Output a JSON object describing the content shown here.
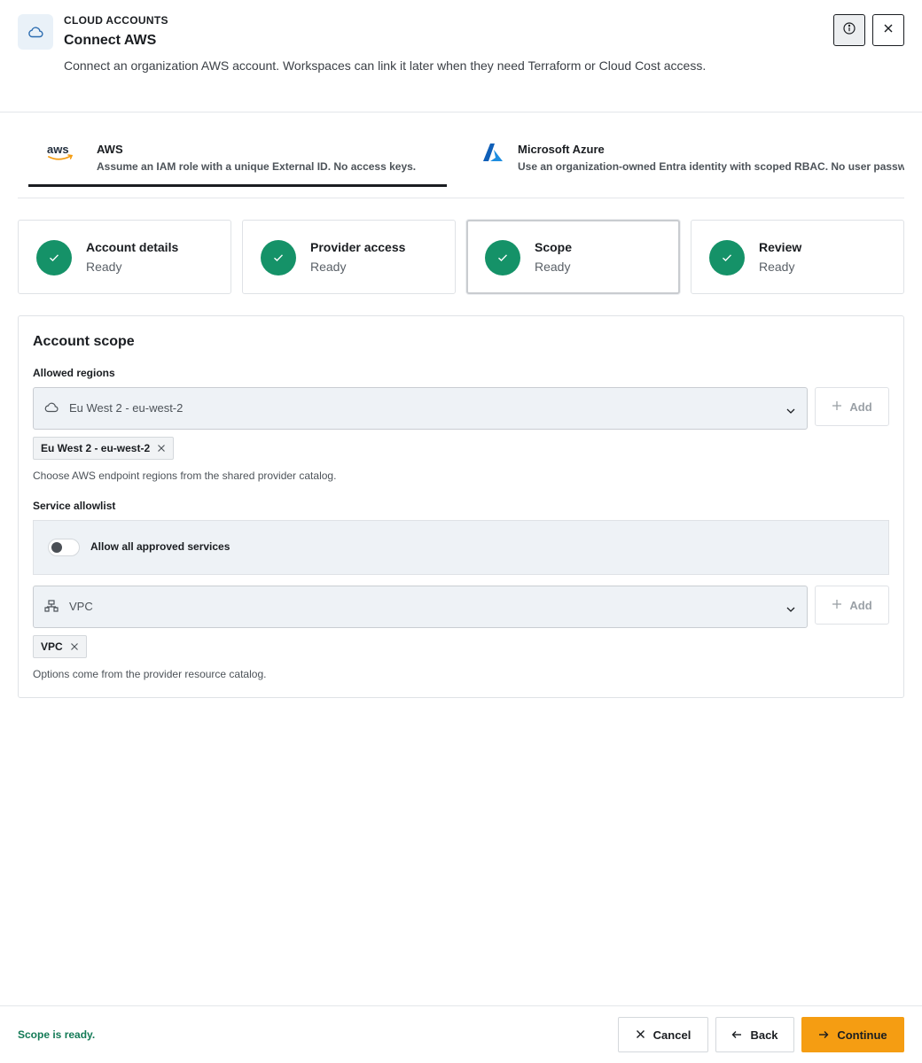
{
  "header": {
    "eyebrow": "CLOUD ACCOUNTS",
    "title": "Connect AWS",
    "description": "Connect an organization AWS account. Workspaces can link it later when they need Terraform or Cloud Cost access.",
    "icon": "cloud-icon"
  },
  "providers": [
    {
      "title": "AWS",
      "subtitle": "Assume an IAM role with a unique External ID. No access keys.",
      "selected": true,
      "icon": "aws-logo"
    },
    {
      "title": "Microsoft Azure",
      "subtitle": "Use an organization-owned Entra identity with scoped RBAC. No user passwords.",
      "selected": false,
      "icon": "azure-logo"
    }
  ],
  "steps": [
    {
      "title": "Account details",
      "status": "Ready"
    },
    {
      "title": "Provider access",
      "status": "Ready"
    },
    {
      "title": "Scope",
      "status": "Ready",
      "active": true
    },
    {
      "title": "Review",
      "status": "Ready"
    }
  ],
  "scope": {
    "title": "Account scope",
    "regions": {
      "label": "Allowed regions",
      "selected": "Eu West 2 - eu-west-2",
      "add_label": "Add",
      "chips": [
        "Eu West 2 - eu-west-2"
      ],
      "help": "Choose AWS endpoint regions from the shared provider catalog."
    },
    "services": {
      "label": "Service allowlist",
      "toggle_label": "Allow all approved services",
      "toggle_on": false,
      "selected": "VPC",
      "add_label": "Add",
      "chips": [
        "VPC"
      ],
      "help": "Options come from the provider resource catalog."
    }
  },
  "footer": {
    "status": "Scope is ready.",
    "cancel": "Cancel",
    "back": "Back",
    "continue": "Continue"
  },
  "colors": {
    "accent": "#f59d12",
    "success": "#159268",
    "success_text": "#137a56"
  }
}
